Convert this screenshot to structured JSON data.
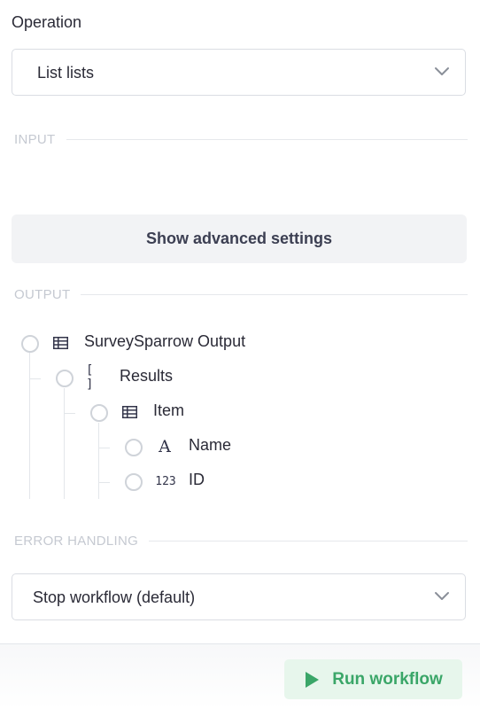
{
  "operation": {
    "label": "Operation",
    "selected": "List lists"
  },
  "sections": {
    "input": "INPUT",
    "output": "OUTPUT",
    "error_handling": "ERROR HANDLING"
  },
  "advanced_button": "Show advanced settings",
  "output_tree": [
    {
      "label": "SurveySparrow Output",
      "icon": "table-icon"
    },
    {
      "label": "Results",
      "icon": "array-icon",
      "icon_text": "[ ]"
    },
    {
      "label": "Item",
      "icon": "table-icon"
    },
    {
      "label": "Name",
      "icon": "text-type-icon",
      "icon_text": "A"
    },
    {
      "label": "ID",
      "icon": "number-type-icon",
      "icon_text": "123"
    }
  ],
  "error_handling": {
    "selected": "Stop workflow (default)"
  },
  "run_button": {
    "label": "Run workflow",
    "color": "#3aa668",
    "background": "#e7f6ec"
  }
}
